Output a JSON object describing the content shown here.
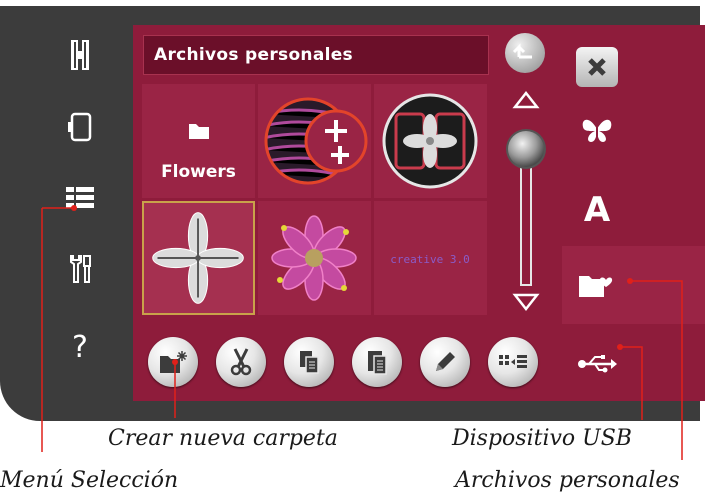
{
  "title_bar": {
    "title": "Archivos personales"
  },
  "left_menu": {
    "items": [
      {
        "icon": "h-logo-icon"
      },
      {
        "icon": "device-icon"
      },
      {
        "icon": "selection-menu-icon"
      },
      {
        "icon": "tools-icon"
      },
      {
        "icon": "help-icon",
        "label": "?"
      }
    ]
  },
  "grid": {
    "folder": {
      "label": "Flowers",
      "icon": "folder-icon"
    },
    "items": [
      {
        "icon": "zebra-moon-design-icon"
      },
      {
        "icon": "digital-flower-design-icon"
      },
      {
        "icon": "four-petal-design-icon",
        "selected": true
      },
      {
        "icon": "pink-flower-design-icon"
      },
      {
        "icon": "text-design-icon",
        "text": "creative 3.0"
      }
    ]
  },
  "scroll": {
    "up_icon": "scroll-up-icon",
    "down_icon": "scroll-down-icon",
    "position": 0.0
  },
  "tabs": [
    {
      "icon": "close-icon"
    },
    {
      "icon": "butterfly-icon"
    },
    {
      "icon": "font-icon",
      "label": "A"
    },
    {
      "icon": "personal-files-icon",
      "active": true
    },
    {
      "icon": "usb-icon"
    }
  ],
  "toolbar": [
    {
      "icon": "new-folder-icon"
    },
    {
      "icon": "cut-icon"
    },
    {
      "icon": "copy-icon"
    },
    {
      "icon": "paste-icon"
    },
    {
      "icon": "rename-icon"
    },
    {
      "icon": "view-toggle-icon"
    }
  ],
  "callouts": {
    "new_folder": "Crear nueva carpeta",
    "selection_menu": "Menú Selección",
    "usb_device": "Dispositivo USB",
    "personal_files": "Archivos personales"
  },
  "colors": {
    "screen": "#8e1c3b",
    "title_bar": "#6b0f29",
    "shell": "#3c3c3c",
    "callout_line": "#e0201a"
  }
}
